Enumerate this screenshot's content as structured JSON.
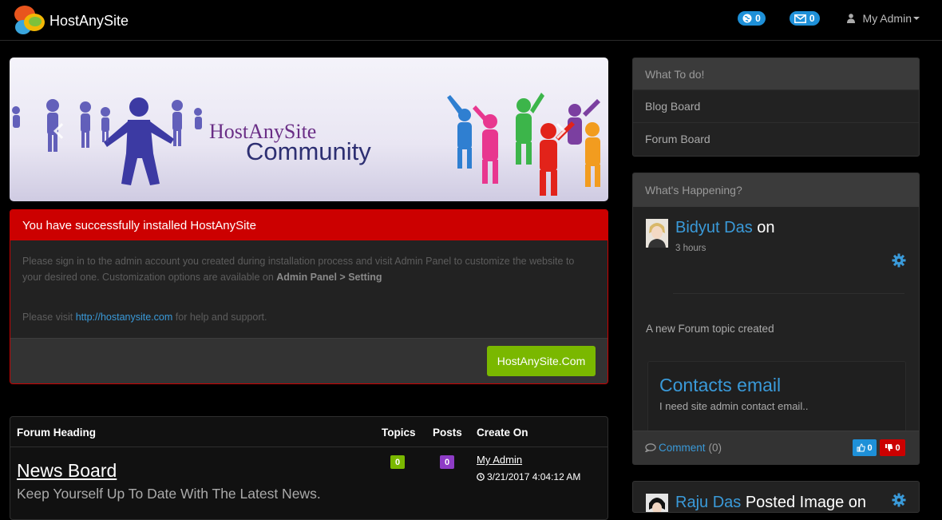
{
  "navbar": {
    "brand": "HostAnySite",
    "notifications_count": "0",
    "messages_count": "0",
    "user_label": "My Admin"
  },
  "banner": {
    "title": "HostAnySite",
    "subtitle": "Community"
  },
  "install_alert": {
    "heading": "You have successfully installed HostAnySite",
    "text_1": "Please sign in to the admin account you created during installation process and visit Admin Panel to customize the website to your desired one. Customization options are available on ",
    "text_1_bold": "Admin Panel > Setting",
    "text_2_pre": "Please visit ",
    "text_2_link": "http://hostanysite.com",
    "text_2_post": " for help and support.",
    "button": "HostAnySite.Com"
  },
  "forum_table": {
    "headers": {
      "heading": "Forum Heading",
      "topics": "Topics",
      "posts": "Posts",
      "created": "Create On"
    },
    "rows": [
      {
        "title": "News Board",
        "description": "Keep Yourself Up To Date With The Latest News.",
        "topics": "0",
        "posts": "0",
        "author": "My Admin",
        "date": "3/21/2017 4:04:12 AM"
      }
    ]
  },
  "todo": {
    "heading": "What To do!",
    "items": [
      "Blog Board",
      "Forum Board"
    ]
  },
  "happening": {
    "heading": "What's Happening?",
    "activity": {
      "user": "Bidyut Das",
      "suffix": "on",
      "time": "3 hours",
      "message": "A new Forum topic created",
      "topic_title": "Contacts email",
      "topic_desc": "I need site admin contact email..",
      "comment_label": "Comment",
      "comment_count": "(0)",
      "likes": "0",
      "dislikes": "0"
    },
    "next_activity": {
      "user": "Raju Das",
      "suffix": "Posted Image on"
    }
  },
  "colors": {
    "accent_blue": "#3a9ad9",
    "alert_red": "#cc0000",
    "button_green": "#7ab800",
    "posts_purple": "#8e3cc6"
  }
}
